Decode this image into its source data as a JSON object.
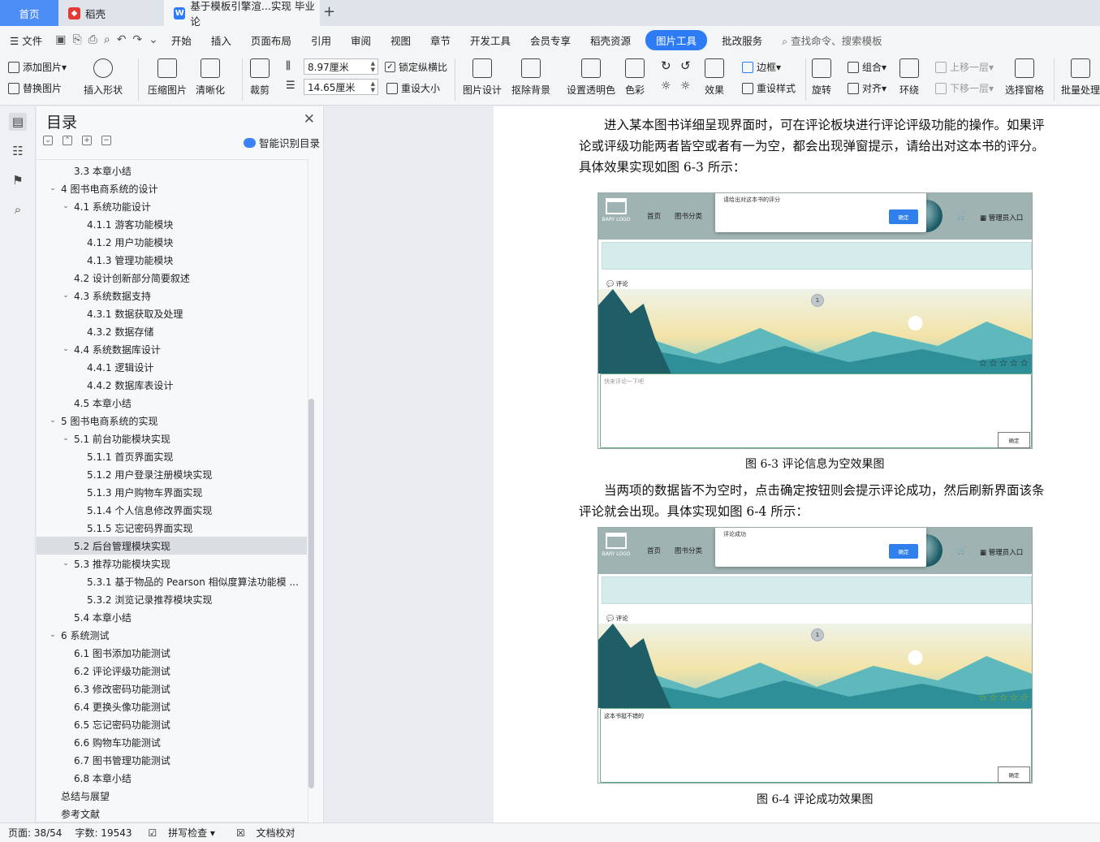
{
  "tabs": {
    "home": "首页",
    "daoke": "稻壳",
    "doc": "基于模板引擎渲...实现 毕业论"
  },
  "menu": {
    "file": "文件",
    "items": [
      "开始",
      "插入",
      "页面布局",
      "引用",
      "审阅",
      "视图",
      "章节",
      "开发工具",
      "会员专享",
      "稻壳资源"
    ],
    "active": "图片工具",
    "after": "批改服务",
    "search": "查找命令、搜索模板"
  },
  "ribbon": {
    "add_image": "添加图片",
    "replace_image": "替换图片",
    "insert_shape": "插入形状",
    "compress": "压缩图片",
    "clarity": "清晰化",
    "crop": "裁剪",
    "width": "8.97厘米",
    "height": "14.65厘米",
    "lock_ratio": "锁定纵横比",
    "reset_size": "重设大小",
    "image_design": "图片设计",
    "remove_bg": "抠除背景",
    "set_transparent": "设置透明色",
    "color": "色彩",
    "effect": "效果",
    "border": "边框",
    "reset_style": "重设样式",
    "rotate": "旋转",
    "group": "组合",
    "align": "对齐",
    "wrap": "环绕",
    "bring_forward": "上移一层",
    "send_backward": "下移一层",
    "selection_pane": "选择窗格",
    "batch": "批量处理"
  },
  "toc": {
    "title": "目录",
    "smart": "智能识别目录",
    "items": [
      {
        "level": 2,
        "text": "3.3  本章小结",
        "caret": ""
      },
      {
        "level": 1,
        "text": "4  图书电商系统的设计",
        "caret": "v"
      },
      {
        "level": 2,
        "text": "4.1  系统功能设计",
        "caret": "v"
      },
      {
        "level": 3,
        "text": "4.1.1  游客功能模块",
        "caret": ""
      },
      {
        "level": 3,
        "text": "4.1.2  用户功能模块",
        "caret": ""
      },
      {
        "level": 3,
        "text": "4.1.3  管理功能模块",
        "caret": ""
      },
      {
        "level": 2,
        "text": "4.2  设计创新部分简要叙述",
        "caret": ""
      },
      {
        "level": 2,
        "text": "4.3  系统数据支持",
        "caret": "v"
      },
      {
        "level": 3,
        "text": "4.3.1  数据获取及处理",
        "caret": ""
      },
      {
        "level": 3,
        "text": "4.3.2  数据存储",
        "caret": ""
      },
      {
        "level": 2,
        "text": "4.4  系统数据库设计",
        "caret": "v"
      },
      {
        "level": 3,
        "text": "4.4.1  逻辑设计",
        "caret": ""
      },
      {
        "level": 3,
        "text": "4.4.2  数据库表设计",
        "caret": ""
      },
      {
        "level": 2,
        "text": "4.5  本章小结",
        "caret": ""
      },
      {
        "level": 1,
        "text": "5  图书电商系统的实现",
        "caret": "v"
      },
      {
        "level": 2,
        "text": "5.1  前台功能模块实现",
        "caret": "v"
      },
      {
        "level": 3,
        "text": "5.1.1  首页界面实现",
        "caret": ""
      },
      {
        "level": 3,
        "text": "5.1.2  用户登录注册模块实现",
        "caret": ""
      },
      {
        "level": 3,
        "text": "5.1.3  用户购物车界面实现",
        "caret": ""
      },
      {
        "level": 3,
        "text": "5.1.4  个人信息修改界面实现",
        "caret": ""
      },
      {
        "level": 3,
        "text": "5.1.5  忘记密码界面实现",
        "caret": ""
      },
      {
        "level": 2,
        "text": "5.2  后台管理模块实现",
        "caret": "",
        "selected": true
      },
      {
        "level": 2,
        "text": "5.3  推荐功能模块实现",
        "caret": "v"
      },
      {
        "level": 3,
        "text": "5.3.1  基于物品的 Pearson 相似度算法功能模 ...",
        "caret": ""
      },
      {
        "level": 3,
        "text": "5.3.2  浏览记录推荐模块实现",
        "caret": ""
      },
      {
        "level": 2,
        "text": "5.4  本章小结",
        "caret": ""
      },
      {
        "level": 1,
        "text": "6  系统测试",
        "caret": "v"
      },
      {
        "level": 2,
        "text": "6.1  图书添加功能测试",
        "caret": ""
      },
      {
        "level": 2,
        "text": "6.2  评论评级功能测试",
        "caret": ""
      },
      {
        "level": 2,
        "text": "6.3  修改密码功能测试",
        "caret": ""
      },
      {
        "level": 2,
        "text": "6.4  更换头像功能测试",
        "caret": ""
      },
      {
        "level": 2,
        "text": "6.5  忘记密码功能测试",
        "caret": ""
      },
      {
        "level": 2,
        "text": "6.6  购物车功能测试",
        "caret": ""
      },
      {
        "level": 2,
        "text": "6.7  图书管理功能测试",
        "caret": ""
      },
      {
        "level": 2,
        "text": "6.8  本章小结",
        "caret": ""
      },
      {
        "level": 0,
        "text": "总结与展望",
        "caret": ""
      },
      {
        "level": 0,
        "text": "参考文献",
        "caret": ""
      }
    ]
  },
  "doc": {
    "para1": "进入某本图书详细呈现界面时，可在评论板块进行评论评级功能的操作。如果评论或评级功能两者皆空或者有一为空，都会出现弹窗提示，请给出对这本书的评分。具体效果实现如图 6-3 所示：",
    "caption1": "图 6-3  评论信息为空效果图",
    "para2": "当两项的数据皆不为空时，点击确定按钮则会提示评论成功，然后刷新界面该条评论就会出现。具体实现如图 6-4 所示：",
    "caption2": "图 6-4  评论成功效果图",
    "shot1": {
      "popup_msg": "请给出对这本书的评分",
      "ok": "确定",
      "logo": "BARY LOGO",
      "nav_home": "首页",
      "nav_cat": "图书分类",
      "admin": "管理员入口",
      "comment": "评论",
      "page": "1",
      "placeholder": "快来评论一下吧",
      "confirm": "确定",
      "stars": "☆☆☆☆☆"
    },
    "shot2": {
      "popup_msg": "评论成功",
      "ok": "确定",
      "logo": "BARY LOGO",
      "nav_home": "首页",
      "nav_cat": "图书分类",
      "admin": "管理员入口",
      "comment": "评论",
      "page": "1",
      "text": "这本书挺不错的",
      "confirm": "确定",
      "stars": "☆☆☆☆☆"
    }
  },
  "status": {
    "page": "页面: 38/54",
    "words": "字数: 19543",
    "spell": "拼写检查",
    "proof": "文档校对"
  }
}
